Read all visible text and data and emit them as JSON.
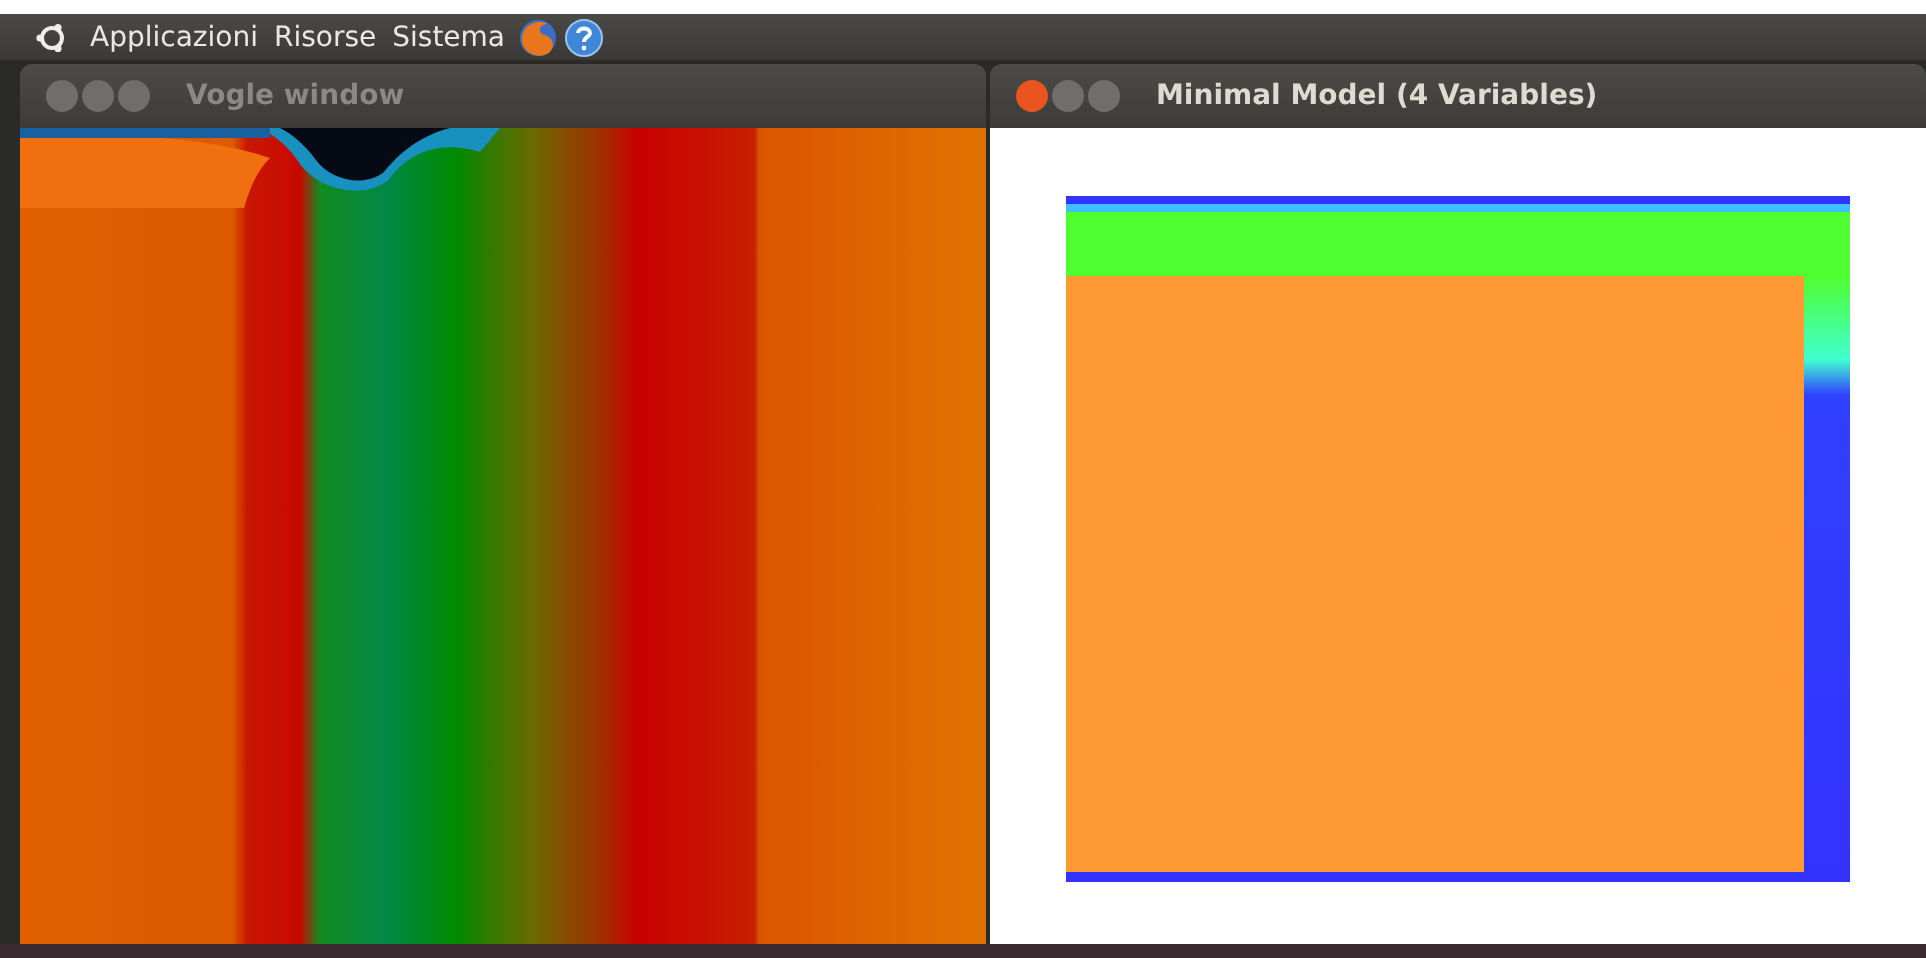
{
  "top_panel": {
    "menus": [
      "Applicazioni",
      "Risorse",
      "Sistema"
    ]
  },
  "windows": [
    {
      "title": "Vogle window",
      "active": false,
      "kind": "bands"
    },
    {
      "title": "Minimal Model (4 Variables)",
      "active": true,
      "kind": "plot"
    }
  ]
}
